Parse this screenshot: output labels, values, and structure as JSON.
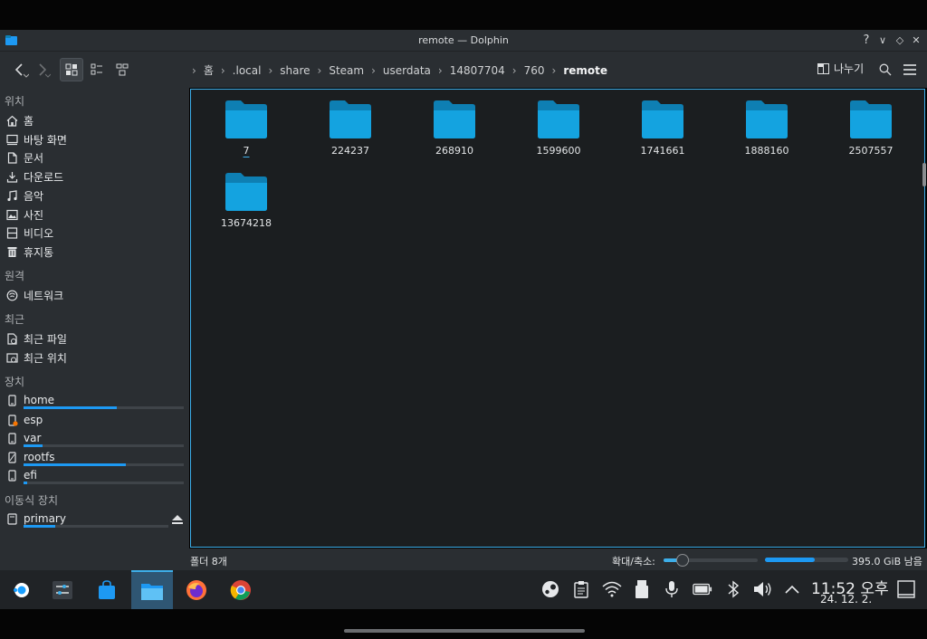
{
  "window": {
    "title": "remote — Dolphin",
    "help": "?",
    "minimize": "∨",
    "maximize": "◇",
    "close": "✕"
  },
  "toolbar": {
    "breadcrumb": [
      "홈",
      ".local",
      "share",
      "Steam",
      "userdata",
      "14807704",
      "760",
      "remote"
    ],
    "breadcrumb_sep": "›",
    "split_label": "나누기"
  },
  "sidebar": {
    "sections": {
      "places": "위치",
      "remote": "원격",
      "recent": "최근",
      "devices": "장치",
      "removable": "이동식 장치"
    },
    "places": [
      "홈",
      "바탕 화면",
      "문서",
      "다운로드",
      "음악",
      "사진",
      "비디오",
      "휴지통"
    ],
    "remote": [
      "네트워크"
    ],
    "recent": [
      "최근 파일",
      "최근 위치"
    ],
    "devices": [
      {
        "label": "home",
        "usage": 0.58
      },
      {
        "label": "esp",
        "usage": null
      },
      {
        "label": "var",
        "usage": 0.12
      },
      {
        "label": "rootfs",
        "usage": 0.64
      },
      {
        "label": "efi",
        "usage": 0.02
      }
    ],
    "removable": [
      {
        "label": "primary",
        "usage": 0.22
      }
    ]
  },
  "folders": [
    "7",
    "224237",
    "268910",
    "1599600",
    "1741661",
    "1888160",
    "2507557",
    "13674218"
  ],
  "status": {
    "count_text": "폴더 8개",
    "zoom_label": "확대/축소:",
    "zoom_level": 0.2,
    "free_space_text": "395.0 GiB 남음",
    "used_fraction": 0.6
  },
  "clock": {
    "time": "11:52 오후",
    "date": "24. 12. 2."
  },
  "colors": {
    "accent": "#3daee9",
    "folder": "#14a3e0",
    "folder_tab": "#0e7fb3"
  }
}
